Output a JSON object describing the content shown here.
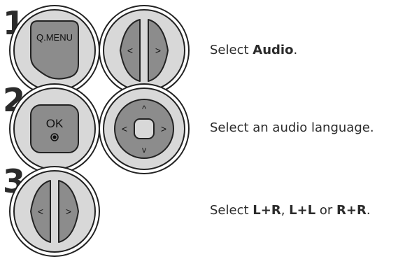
{
  "steps": [
    {
      "number": "1",
      "buttons": {
        "qmenu_label": "Q.MENU",
        "arrow_left": "<",
        "arrow_right": ">"
      },
      "instruction": {
        "prefix": "Select ",
        "bold": "Audio",
        "suffix": "."
      }
    },
    {
      "number": "2",
      "buttons": {
        "ok_label": "OK",
        "arrow_up": "^",
        "arrow_down": "v",
        "arrow_left": "<",
        "arrow_right": ">"
      },
      "instruction": {
        "text": "Select an audio language."
      }
    },
    {
      "number": "3",
      "buttons": {
        "arrow_left": "<",
        "arrow_right": ">"
      },
      "instruction": {
        "prefix": "Select ",
        "bold1": "L+R",
        "sep1": ", ",
        "bold2": "L+L",
        "sep2": " or ",
        "bold3": "R+R",
        "suffix": "."
      }
    }
  ]
}
